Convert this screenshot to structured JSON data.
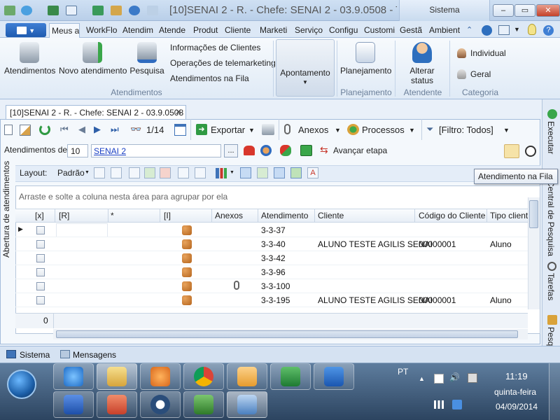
{
  "window": {
    "title": "[10]SENAI 2 - R. - Chefe: SENAI 2 - 03.9.0508 - T...",
    "context_tab": "Sistema",
    "min": "–",
    "max": "▭",
    "close": "✕"
  },
  "ribbon_tabs": [
    "Meus at",
    "WorkFlo",
    "Atendim",
    "Atende",
    "Produt",
    "Cliente",
    "Marketi",
    "Serviço",
    "Configu",
    "Customi",
    "Gestã",
    "Ambient"
  ],
  "ribbon": {
    "atendimentos": {
      "btn1": "Atendimentos",
      "btn2": "Novo atendimento",
      "btn3": "Pesquisa",
      "link1": "Informações de Clientes",
      "link2": "Operações de telemarketing",
      "link3": "Atendimentos na Fila",
      "group": "Atendimentos"
    },
    "apontamento": {
      "btn": "Apontamento"
    },
    "planejamento": {
      "btn": "Planejamento",
      "group": "Planejamento"
    },
    "atendente": {
      "btn": "Alterar status",
      "group": "Atendente"
    },
    "categoria": {
      "btn1": "Individual",
      "btn2": "Geral",
      "group": "Categoria"
    }
  },
  "doc_tab": {
    "title": "[10]SENAI 2 - R. - Chefe: SENAI 2 - 03.9.0508",
    "close": "✕"
  },
  "toolbar": {
    "page": "1/14",
    "exportar": "Exportar",
    "anexos": "Anexos",
    "processos": "Processos",
    "filtro": "[Filtro: Todos]"
  },
  "toolbar2": {
    "label": "Atendimentos de:",
    "number": "10",
    "link": "SENAI 2",
    "ellipsis": "...",
    "avancar": "Avançar etapa"
  },
  "layoutbar": {
    "layout": "Layout:",
    "padrao": "Padrão"
  },
  "grid": {
    "group_hint": "Arraste e solte a coluna nesta área para agrupar por ela",
    "headers": [
      "[x]",
      "[R]",
      "*",
      "[I]",
      "Anexos",
      "Atendimento",
      "Cliente",
      "Código do Cliente",
      "Tipo cliente"
    ],
    "rows": [
      {
        "atendimento": "3-3-37",
        "cliente": "",
        "codigo": "",
        "tipo": "",
        "anexo": false
      },
      {
        "atendimento": "3-3-40",
        "cliente": "ALUNO TESTE AGILIS SENAI",
        "codigo": "00000001",
        "tipo": "Aluno",
        "anexo": false
      },
      {
        "atendimento": "3-3-42",
        "cliente": "",
        "codigo": "",
        "tipo": "",
        "anexo": false
      },
      {
        "atendimento": "3-3-96",
        "cliente": "",
        "codigo": "",
        "tipo": "",
        "anexo": false
      },
      {
        "atendimento": "3-3-100",
        "cliente": "",
        "codigo": "",
        "tipo": "",
        "anexo": true
      },
      {
        "atendimento": "3-3-195",
        "cliente": "ALUNO TESTE AGILIS SENAI",
        "codigo": "00000001",
        "tipo": "Aluno",
        "anexo": false
      }
    ],
    "footer_count": "0"
  },
  "tooltip": "Atendimento na Fila",
  "side_tabs": {
    "left": "Abertura de atendimentos",
    "right": [
      "Executar",
      "Central de Pesquisa",
      "Tarefas",
      "Pesquisa"
    ]
  },
  "statusbar": {
    "sistema": "Sistema",
    "mensagens": "Mensagens"
  },
  "taskbar": {
    "lang": "PT",
    "time": "11:19",
    "day": "quinta-feira",
    "date": "04/09/2014"
  },
  "colors": {
    "accent": "#1e5bb0",
    "link": "#1a40c4"
  }
}
